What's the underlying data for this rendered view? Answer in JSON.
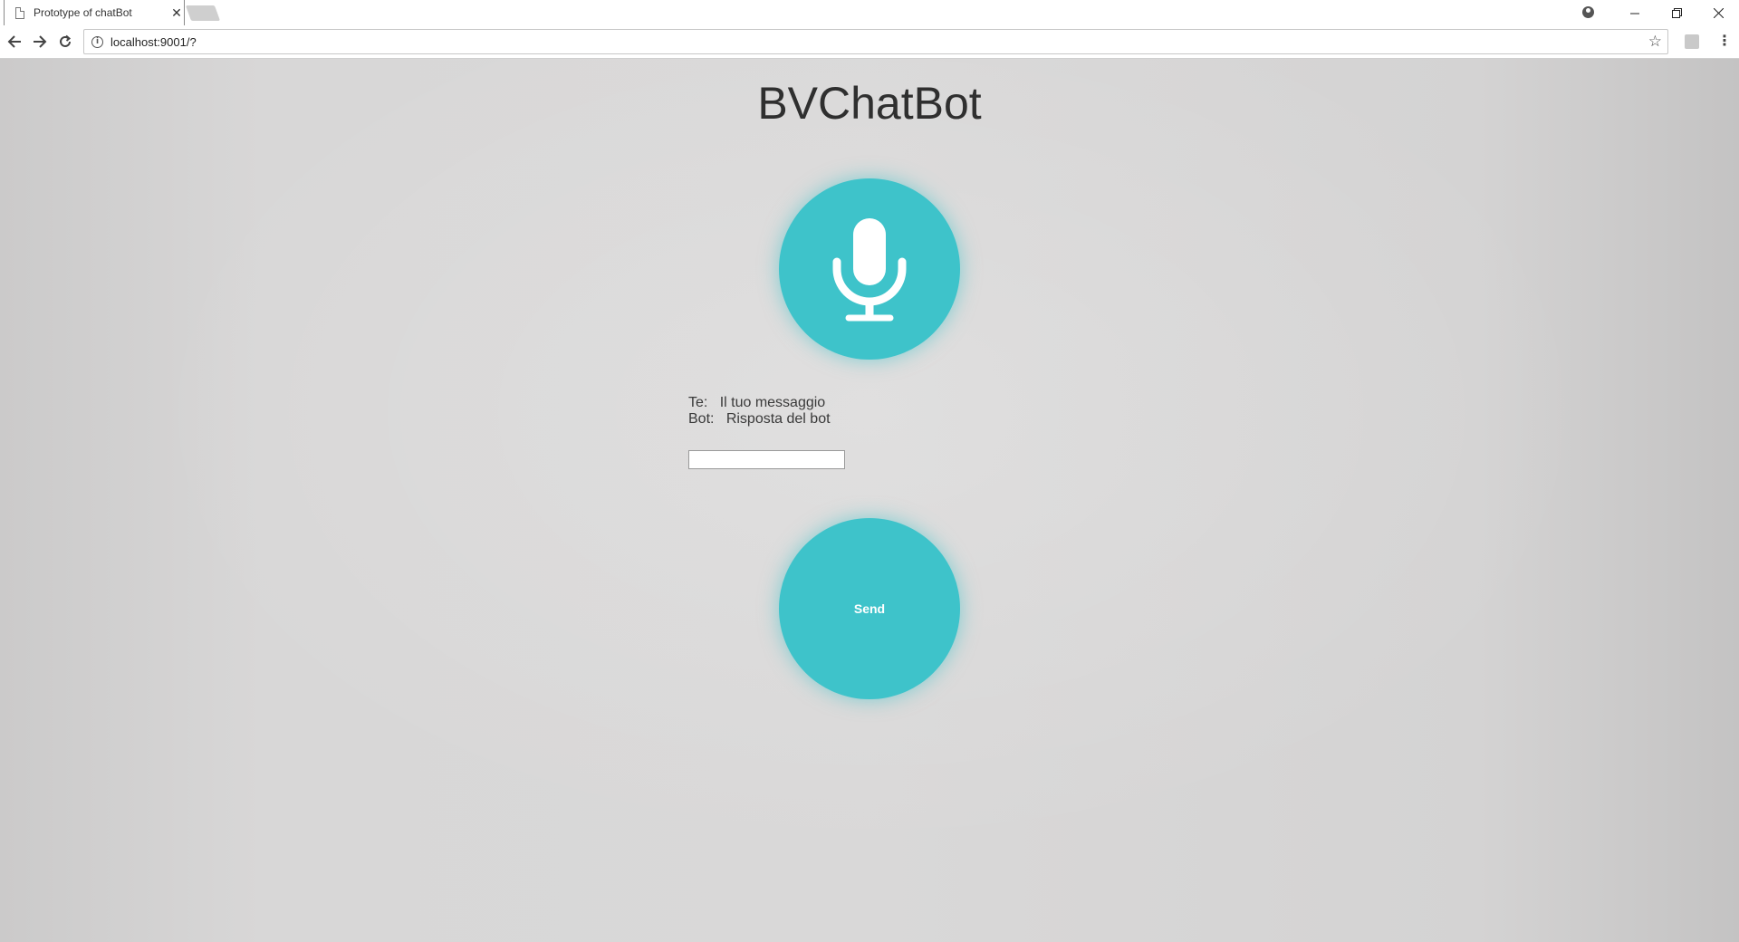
{
  "browser": {
    "tab_title": "Prototype of chatBot",
    "url": "localhost:9001/?"
  },
  "page": {
    "title": "BVChatBot",
    "conversation": [
      {
        "speaker": "Te:",
        "text": "Il tuo messaggio"
      },
      {
        "speaker": "Bot:",
        "text": "Risposta del bot"
      }
    ],
    "message_input_value": "",
    "send_label": "Send"
  },
  "colors": {
    "accent": "#3ec3ca",
    "background": "#d6d5d5"
  },
  "icons": {
    "mic": "microphone-icon"
  }
}
